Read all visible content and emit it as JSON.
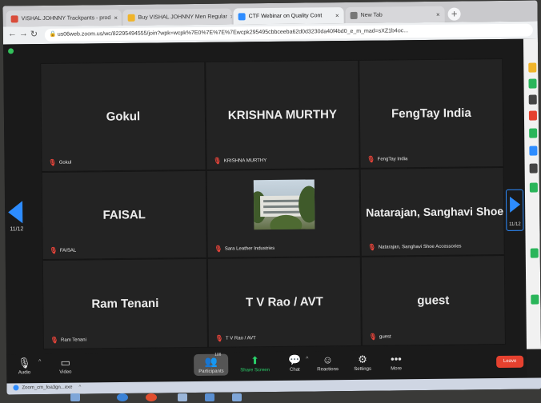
{
  "browser": {
    "tabs": [
      {
        "title": "VISHAL JOHNNY Trackpants - prod",
        "color": "#d94c3a",
        "active": false
      },
      {
        "title": "Buy VISHAL JOHNNY Men Regular",
        "color": "#f0b429",
        "active": false
      },
      {
        "title": "CTF Webinar on Quality Cont",
        "color": "#2d8cff",
        "active": true
      },
      {
        "title": "New Tab",
        "color": "#555555",
        "active": false
      }
    ],
    "back_icon": "back-arrow-icon",
    "forward_icon": "forward-arrow-icon",
    "reload_icon": "reload-icon",
    "url": "us06web.zoom.us/wc/82295494555/join?wpk=wcpk%7E0%7E%7E%7Ewcpk295495cbbceeba62d0d3230da40f4bd0_e_m_mad=sXZ1b4oc..."
  },
  "meeting": {
    "page_left": "11/12",
    "page_right": "11/12",
    "participants": [
      {
        "display": "Gokul",
        "tag": "Gokul"
      },
      {
        "display": "KRISHNA MURTHY",
        "tag": "KRISHNA MURTHY"
      },
      {
        "display": "FengTay India",
        "tag": "FengTay India"
      },
      {
        "display": "FAISAL",
        "tag": "FAISAL"
      },
      {
        "display": "",
        "tag": "Sara Leather Industries",
        "has_photo": true
      },
      {
        "display": "Natarajan, Sanghavi Shoe ...",
        "tag": "Natarajan, Sanghavi Shoe Accessories"
      },
      {
        "display": "Ram Tenani",
        "tag": "Ram Tenani"
      },
      {
        "display": "T V Rao / AVT",
        "tag": "T V Rao / AVT"
      },
      {
        "display": "guest",
        "tag": "guest"
      }
    ]
  },
  "toolbar": {
    "audio": "Audio",
    "video": "Video",
    "participants": "Participants",
    "participants_count": "108",
    "share": "Share Screen",
    "chat": "Chat",
    "reactions": "Reactions",
    "settings": "Settings",
    "more": "More",
    "leave": "Leave"
  },
  "taskbar": {
    "download": "Zoom_cm_foa3gn...exe",
    "download_caret": "^"
  },
  "colors": {
    "accent": "#2d8cff",
    "leave": "#e5412f",
    "share": "#2ad06a",
    "tile": "#232323"
  }
}
